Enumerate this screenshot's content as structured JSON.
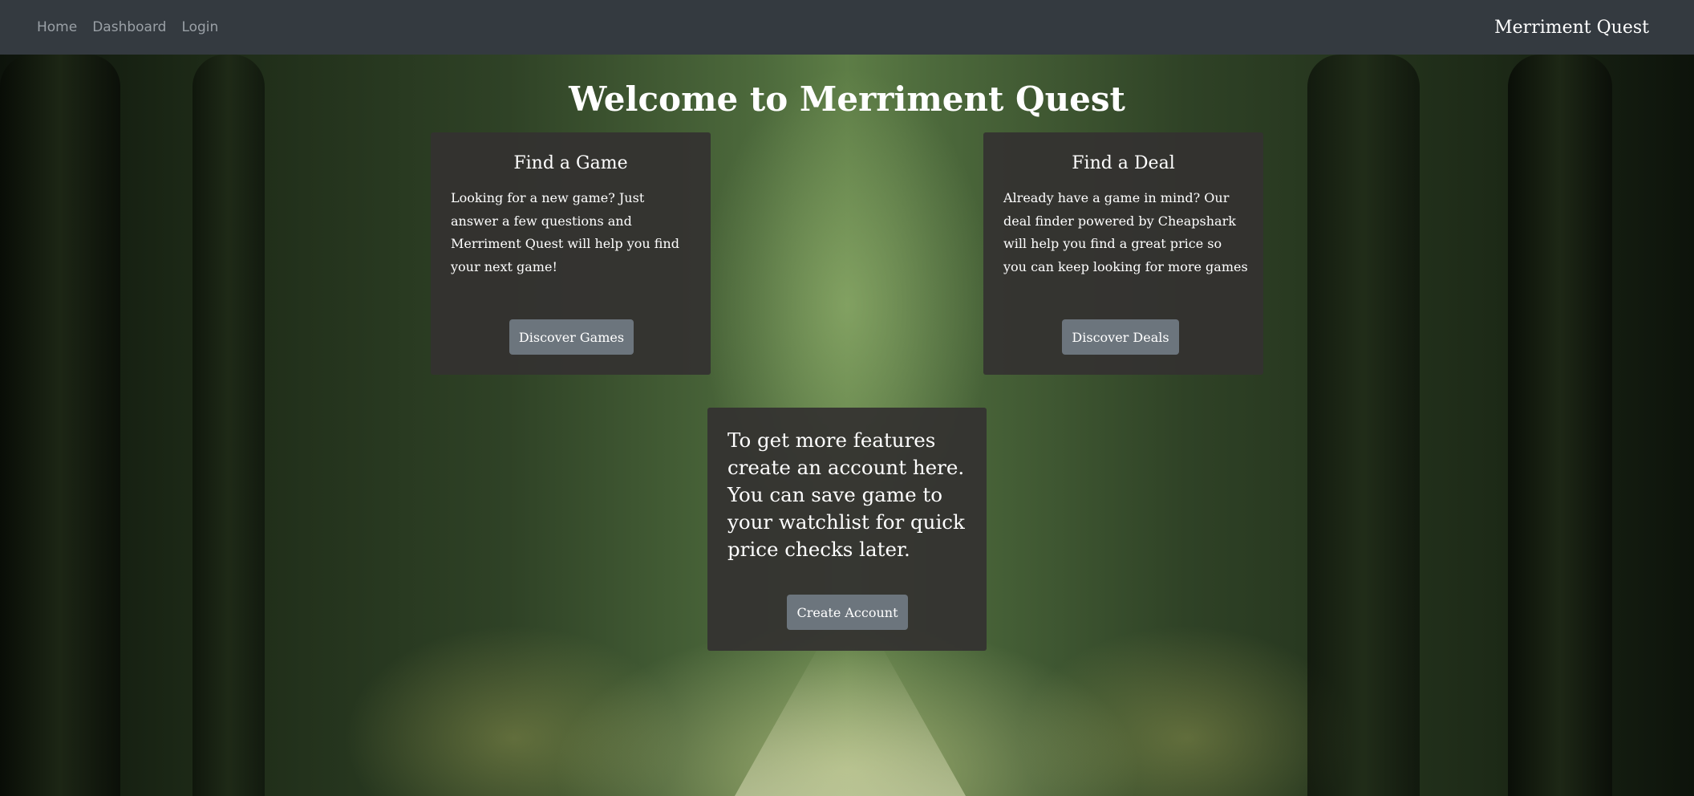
{
  "nav": {
    "links": [
      "Home",
      "Dashboard",
      "Login"
    ],
    "brand": "Merriment Quest"
  },
  "headline": "Welcome to Merriment Quest",
  "cards": {
    "game": {
      "title": "Find a Game",
      "text": "Looking for a new game? Just answer a few questions and Merriment Quest will help you find your next game!",
      "button": "Discover Games"
    },
    "deal": {
      "title": "Find a Deal",
      "text": "Already have a game in mind? Our deal finder powered by Cheapshark will help you find a great price so you can keep looking for more games",
      "button": "Discover Deals"
    },
    "account": {
      "text": "To get more features create an account here. You can save game to your watchlist for quick price checks later.",
      "button": "Create Account"
    }
  },
  "colors": {
    "navbar": "#343a40",
    "card": "#343230",
    "button": "#6c757d",
    "text": "#ffffff",
    "nav_link": "#9aa0a6"
  }
}
